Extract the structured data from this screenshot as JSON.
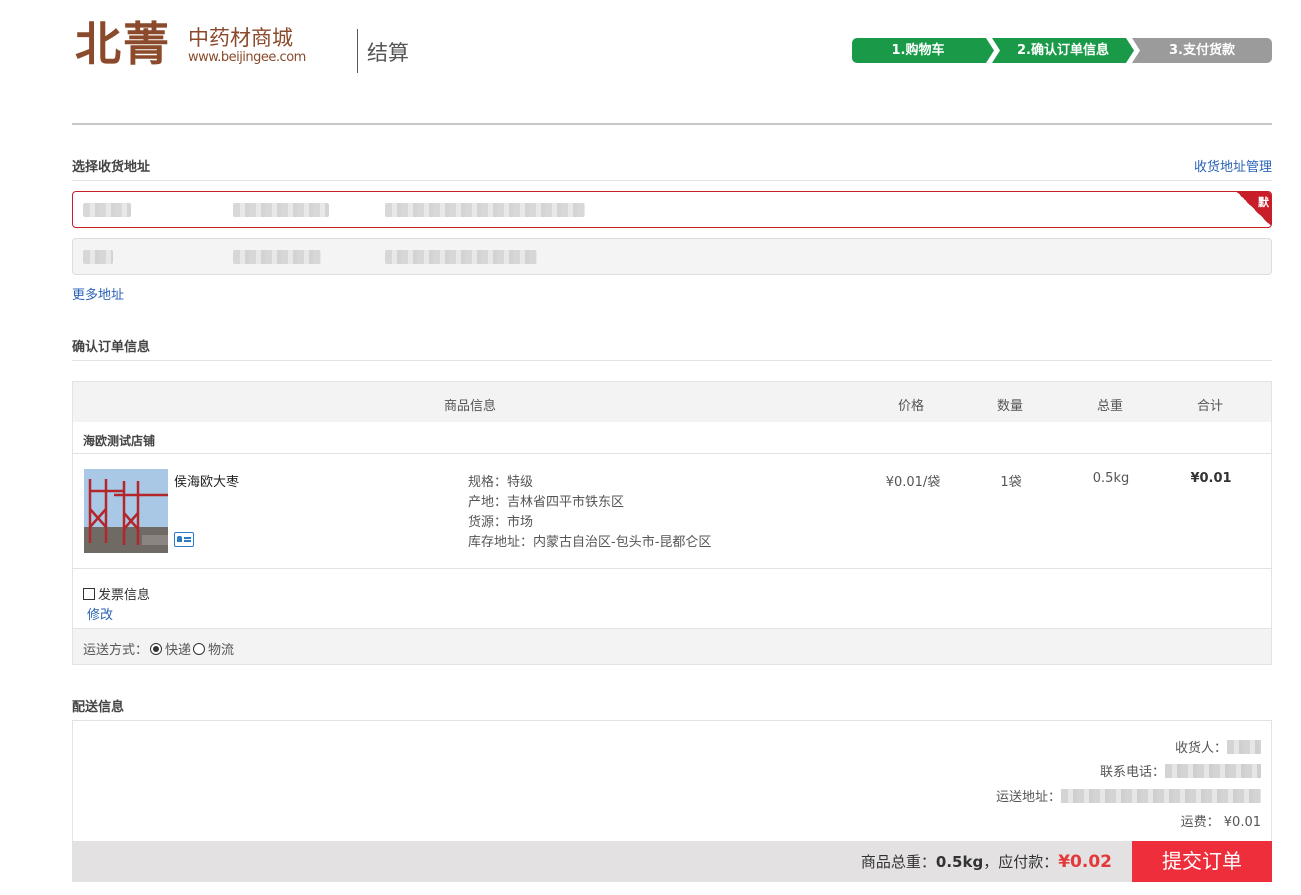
{
  "header": {
    "logo_main": "北菁",
    "logo_sub": "中药材商城",
    "logo_url": "www.beijingee.com",
    "page_title": "结算",
    "steps": [
      "1.购物车",
      "2.确认订单信息",
      "3.支付货款"
    ]
  },
  "address_section": {
    "title": "选择收货地址",
    "manage_link": "收货地址管理",
    "default_badge": "默",
    "more_link": "更多地址"
  },
  "order_section": {
    "title": "确认订单信息",
    "columns": [
      "商品信息",
      "价格",
      "数量",
      "总重",
      "合计"
    ],
    "shop_name": "海欧测试店铺",
    "item": {
      "name": "侯海欧大枣",
      "spec": "规格：特级",
      "origin": "产地：吉林省四平市铁东区",
      "source": "货源：市场",
      "warehouse": "库存地址：内蒙古自治区-包头市-昆都仑区",
      "price": "¥0.01/袋",
      "quantity": "1袋",
      "weight": "0.5kg",
      "total": "¥0.01"
    },
    "invoice_label": "发票信息",
    "edit_link": "修改",
    "shipping": {
      "label": "运送方式：",
      "options": [
        "快递",
        "物流"
      ],
      "selected": "快递"
    }
  },
  "delivery_section": {
    "title": "配送信息",
    "receiver_label": "收货人：",
    "phone_label": "联系电话：",
    "address_label": "运送地址：",
    "fee_label": "运费：",
    "fee_value": "¥0.01"
  },
  "summary": {
    "weight_label": "商品总重：",
    "weight_value": "0.5kg",
    "pay_label": "，应付款：",
    "pay_value": "¥0.02",
    "submit_label": "提交订单"
  },
  "colors": {
    "brand": "#8b4a2b",
    "step_active": "#1a9a48",
    "step_inactive": "#9b9b9b",
    "accent_red": "#e4393c",
    "link": "#2b62b6"
  }
}
